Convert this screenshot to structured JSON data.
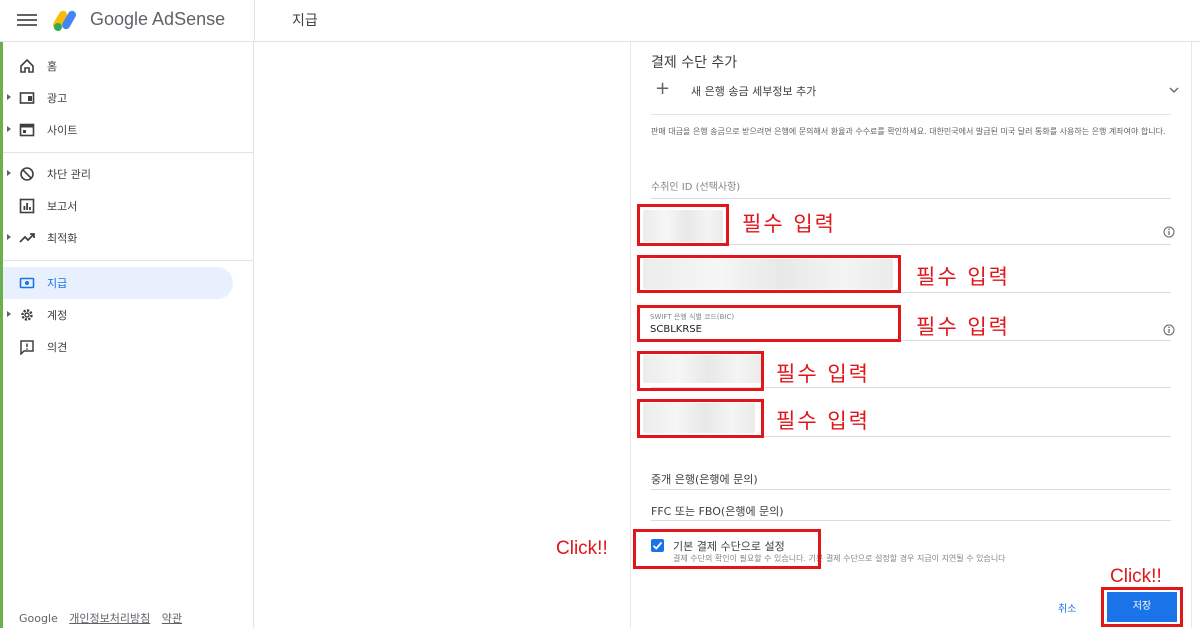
{
  "header": {
    "brand": "Google AdSense",
    "page_title": "지급"
  },
  "sidebar": {
    "items": [
      {
        "label": "홈",
        "icon": "home-icon"
      },
      {
        "label": "광고",
        "icon": "ads-icon"
      },
      {
        "label": "사이트",
        "icon": "sites-icon"
      },
      {
        "label": "차단 관리",
        "icon": "block-icon"
      },
      {
        "label": "보고서",
        "icon": "reports-icon"
      },
      {
        "label": "최적화",
        "icon": "trending-icon"
      },
      {
        "label": "지급",
        "icon": "payments-icon"
      },
      {
        "label": "계정",
        "icon": "settings-icon"
      },
      {
        "label": "의견",
        "icon": "feedback-icon"
      }
    ],
    "active": "지급",
    "footer": {
      "brand": "Google",
      "privacy": "개인정보처리방침",
      "terms": "약관"
    }
  },
  "form": {
    "title": "결제 수단 추가",
    "add_bank_label": "새 은행 송금 세부정보 추가",
    "notice": "판매 대금을 은행 송금으로 받으려면 은행에 문의해서 환율과 수수료를 확인하세요. 대한민국에서 발급된 미국 달러 통화를 사용하는 은행 계좌여야 합니다.",
    "payee_id_label": "수취인 ID (선택사항)",
    "swift_label": "SWIFT 은행 식별 코드(BIC)",
    "swift_value": "SCBLKRSE",
    "intermediary_label": "중개 은행(은행에 문의)",
    "ffc_label": "FFC 또는 FBO(은행에 문의)",
    "default_checkbox_label": "기본 결제 수단으로 설정",
    "default_checkbox_checked": true,
    "default_checkbox_sub": "결제 수단의 확인이 필요할 수 있습니다. 기본 결제 수단으로 설정할 경우 지급이 지연될 수 있습니다",
    "cancel_label": "취소",
    "save_label": "저장"
  },
  "annotations": {
    "required_label": "필수 입력",
    "click_label": "Click!!",
    "color": "#e0161b"
  },
  "colors": {
    "accent": "#1a73e8",
    "annotation_red": "#e0161b"
  }
}
